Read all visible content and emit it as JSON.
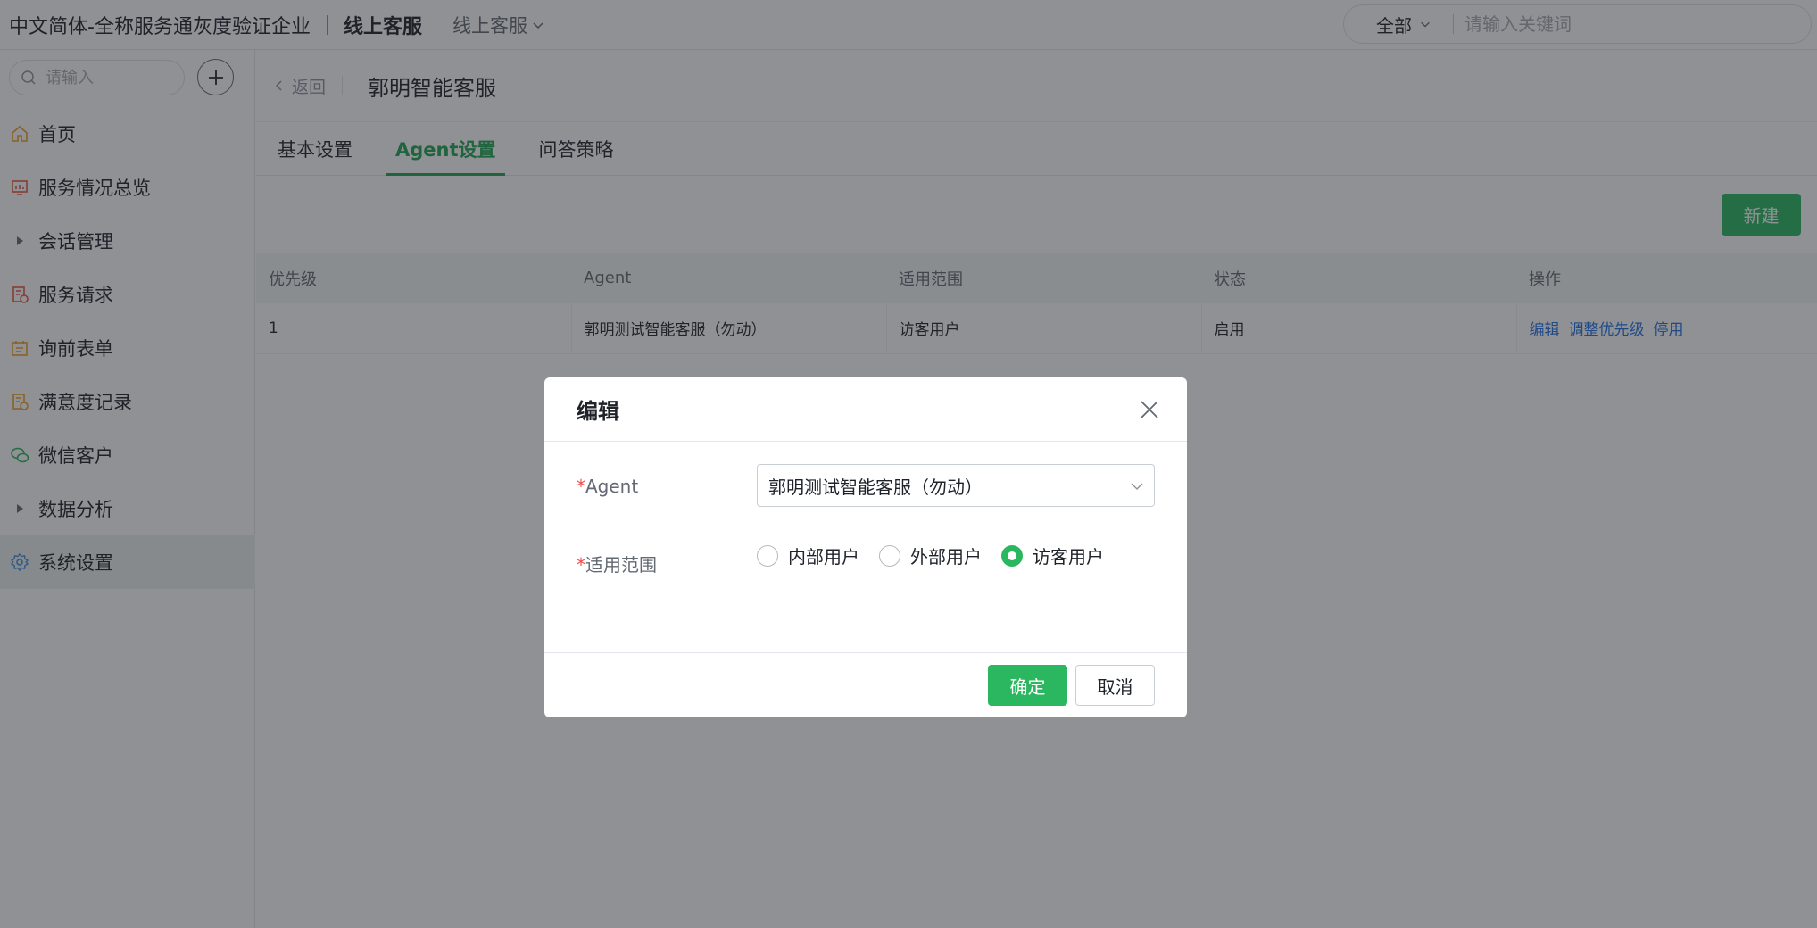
{
  "topbar": {
    "org_name": "中文简体-全称服务通灰度验证企业",
    "product_name": "线上客服",
    "product_switch_label": "线上客服",
    "search_scope": "全部",
    "search_placeholder": "请输入关键词"
  },
  "sidebar": {
    "search_placeholder": "请输入",
    "items": [
      {
        "label": "首页",
        "icon": "home-icon"
      },
      {
        "label": "服务情况总览",
        "icon": "dashboard-icon"
      },
      {
        "label": "会话管理",
        "icon": "caret-right-icon"
      },
      {
        "label": "服务请求",
        "icon": "request-icon"
      },
      {
        "label": "询前表单",
        "icon": "form-icon"
      },
      {
        "label": "满意度记录",
        "icon": "satisfaction-icon"
      },
      {
        "label": "微信客户",
        "icon": "wechat-icon"
      },
      {
        "label": "数据分析",
        "icon": "caret-right-icon"
      },
      {
        "label": "系统设置",
        "icon": "gear-icon",
        "active": true
      }
    ]
  },
  "page": {
    "back_label": "返回",
    "title": "郭明智能客服",
    "tabs": [
      "基本设置",
      "Agent设置",
      "问答策略"
    ],
    "active_tab": "Agent设置",
    "new_button": "新建"
  },
  "table": {
    "columns": [
      "优先级",
      "Agent",
      "适用范围",
      "状态",
      "操作"
    ],
    "rows": [
      {
        "priority": "1",
        "agent": "郭明测试智能客服（勿动）",
        "scope": "访客用户",
        "status": "启用",
        "actions": [
          "编辑",
          "调整优先级",
          "停用"
        ]
      }
    ]
  },
  "modal": {
    "title": "编辑",
    "agent_label": "Agent",
    "agent_value": "郭明测试智能客服（勿动）",
    "scope_label": "适用范围",
    "required_mark": "*",
    "scope_options": [
      "内部用户",
      "外部用户",
      "访客用户"
    ],
    "scope_selected": "访客用户",
    "ok_button": "确定",
    "cancel_button": "取消"
  },
  "colors": {
    "accent": "#2bb75f",
    "link": "#1f6fe5",
    "required": "#f54a45",
    "overlay": "rgba(31,35,41,0.5)"
  }
}
